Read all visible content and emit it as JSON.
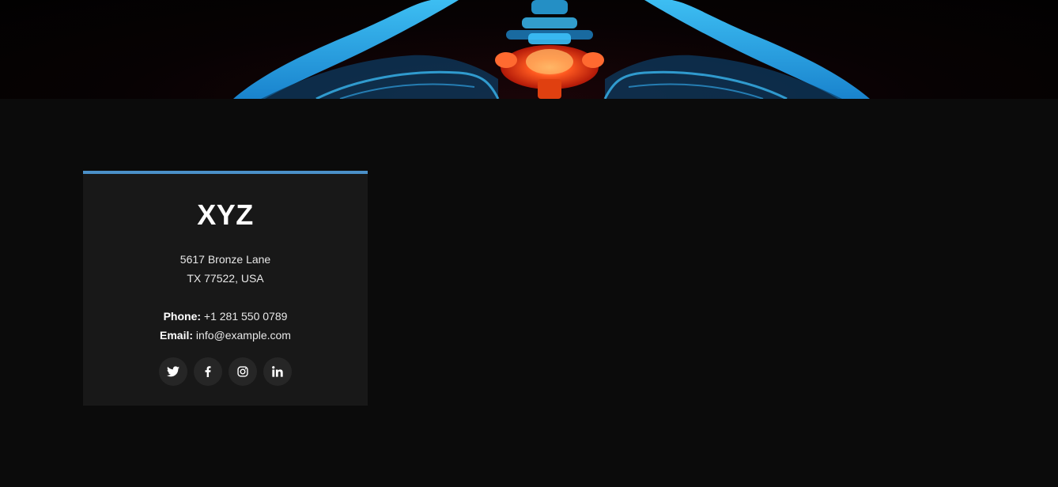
{
  "hero": {
    "image_icon": "spine-xray-image"
  },
  "contact_card": {
    "title": "XYZ",
    "address_line1": "5617 Bronze Lane",
    "address_line2": "TX 77522, USA",
    "phone_label": "Phone:",
    "phone_value": "+1 281 550 0789",
    "email_label": "Email:",
    "email_value": "info@example.com",
    "accent_color": "#4a90c8",
    "socials": [
      "twitter-icon",
      "facebook-icon",
      "instagram-icon",
      "linkedin-icon"
    ]
  }
}
